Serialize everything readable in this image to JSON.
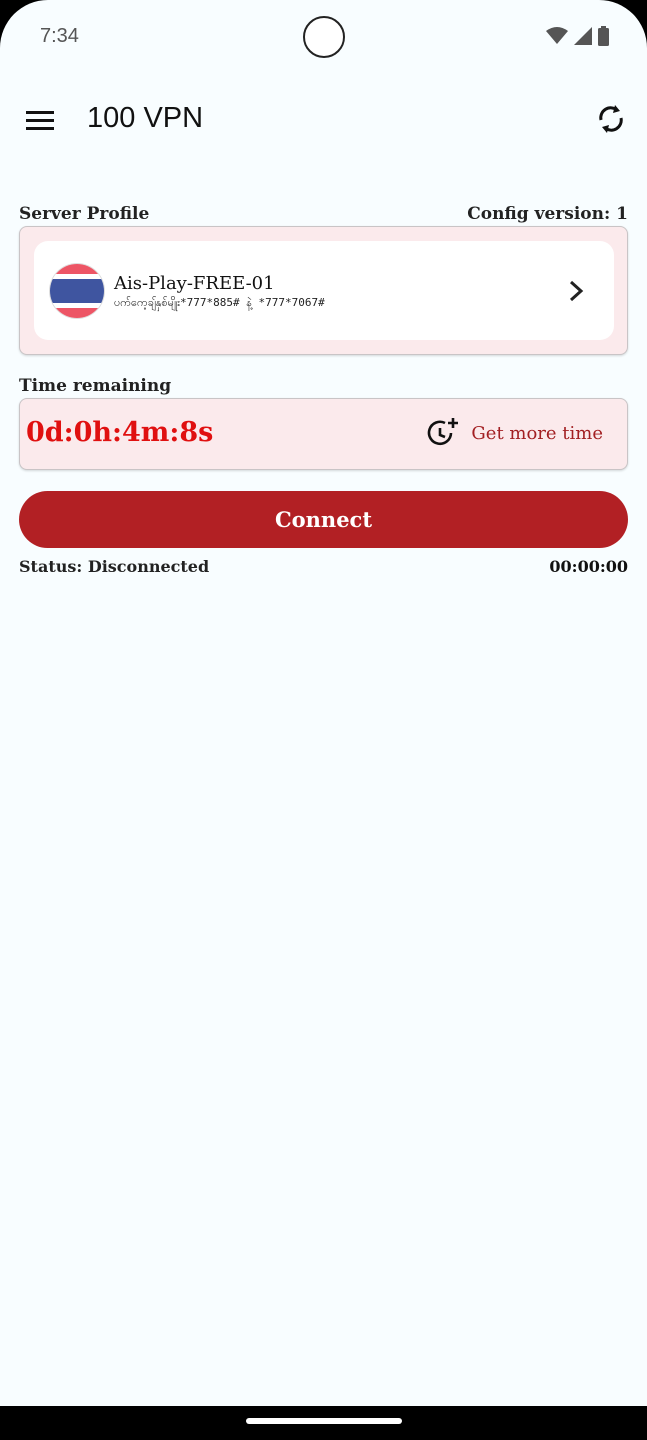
{
  "status_bar": {
    "time": "7:34",
    "icons": [
      "wifi-icon",
      "signal-icon",
      "battery-icon"
    ]
  },
  "app_bar": {
    "title": "100 VPN",
    "menu_icon": "menu-icon",
    "refresh_icon": "refresh-icon"
  },
  "server_section": {
    "label": "Server Profile",
    "config_version": "Config version: 1",
    "server_name": "Ais-Play-FREE-01",
    "server_detail": "ပက်ကေ့ချ်နှစ်မျိုး*777*885# နဲ့ *777*7067#",
    "flag": "thailand-flag"
  },
  "time_section": {
    "label": "Time remaining",
    "value": "0d:0h:4m:8s",
    "more_time_label": "Get more time"
  },
  "connect": {
    "button_label": "Connect",
    "status": "Status: Disconnected",
    "timer": "00:00:00"
  },
  "colors": {
    "accent": "#b22024",
    "countdown": "#e01010",
    "card_bg": "#fbeaec",
    "background": "#f8fdff"
  }
}
